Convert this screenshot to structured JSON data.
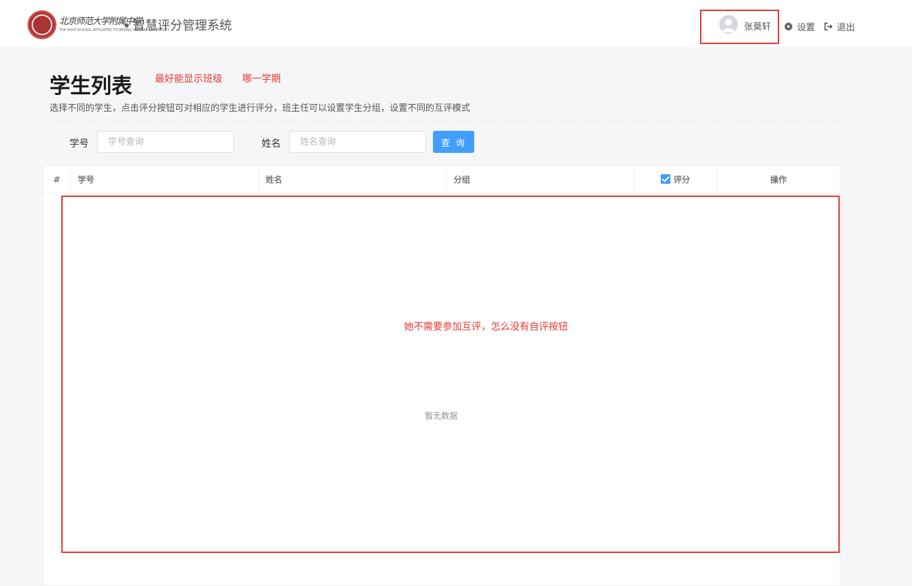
{
  "header": {
    "logo_cn": "北京师范大学附属中学",
    "logo_en": "THE HIGH SCHOOL AFFILIATED TO BEIJING NORMAL UNIVERSITY",
    "system_title": "智慧评分管理系统",
    "username": "张莫轩",
    "settings_label": "设置",
    "logout_label": "退出"
  },
  "page": {
    "title": "学生列表",
    "note_class": "最好能显示班级",
    "note_term": "哪一学期",
    "description": "选择不同的学生，点击评分按钮可对相应的学生进行评分，班主任可以设置学生分组，设置不同的互评模式"
  },
  "search": {
    "id_label": "学号",
    "id_placeholder": "学号查询",
    "name_label": "姓名",
    "name_placeholder": "姓名查询",
    "query_button": "查 询"
  },
  "table": {
    "columns": [
      "#",
      "学号",
      "姓名",
      "分组",
      "评分",
      "操作"
    ],
    "score_checked": true,
    "empty_text": "暂无数据"
  },
  "annotation": {
    "text": "她不需要参加互评，怎么没有自评按钮"
  },
  "colors": {
    "annotation_red": "#e53935",
    "primary_blue": "#409eff",
    "background": "#f5f6f8"
  }
}
